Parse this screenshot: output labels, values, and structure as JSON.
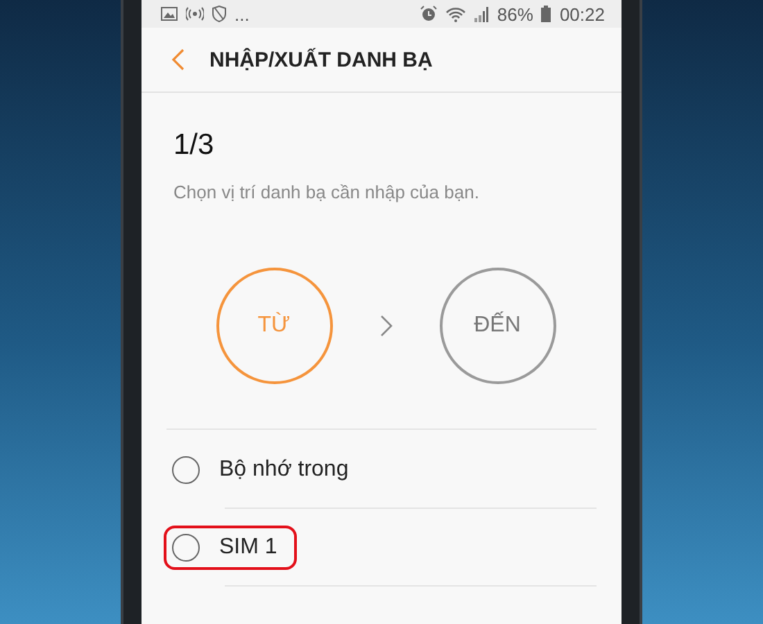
{
  "status_bar": {
    "notifications_more": "...",
    "battery": "86%",
    "time": "00:22"
  },
  "header": {
    "title": "NHẬP/XUẤT DANH BẠ"
  },
  "step": {
    "counter": "1/3",
    "instruction": "Chọn vị trí danh bạ cần nhập của bạn."
  },
  "steps": [
    {
      "label": "TỪ",
      "active": true
    },
    {
      "label": "ĐẾN",
      "active": false
    }
  ],
  "options": [
    {
      "label": "Bộ nhớ trong",
      "selected": false,
      "highlighted": false
    },
    {
      "label": "SIM 1",
      "selected": false,
      "highlighted": true
    }
  ]
}
